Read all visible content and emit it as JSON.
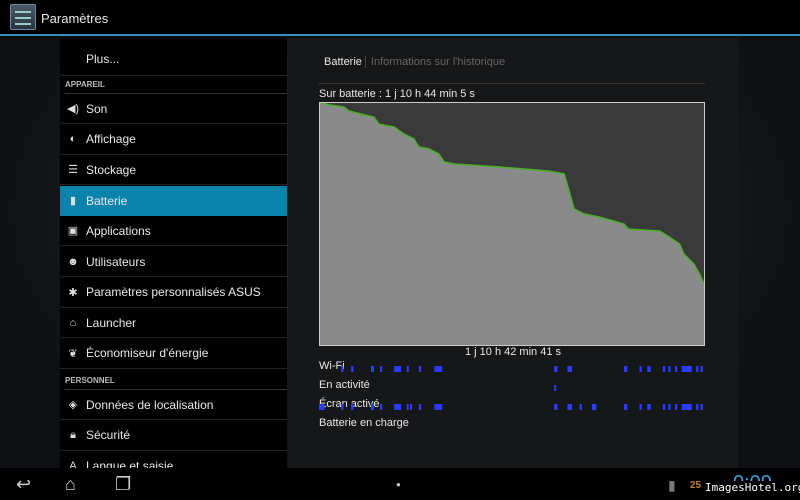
{
  "app": {
    "title": "Paramètres"
  },
  "sidebar": {
    "more": "Plus...",
    "section_device": "APPAREIL",
    "section_personal": "PERSONNEL",
    "items": [
      {
        "label": "Son",
        "icon": "speaker-icon",
        "glyph": "◀)"
      },
      {
        "label": "Affichage",
        "icon": "brightness-icon",
        "glyph": "◐"
      },
      {
        "label": "Stockage",
        "icon": "storage-icon",
        "glyph": "☰"
      },
      {
        "label": "Batterie",
        "icon": "battery-icon",
        "glyph": "▮",
        "selected": true
      },
      {
        "label": "Applications",
        "icon": "apps-icon",
        "glyph": "▣"
      },
      {
        "label": "Utilisateurs",
        "icon": "user-icon",
        "glyph": "☻"
      },
      {
        "label": "Paramètres personnalisés ASUS",
        "icon": "gear-icon",
        "glyph": "✱"
      },
      {
        "label": "Launcher",
        "icon": "home-gear-icon",
        "glyph": "⌂"
      },
      {
        "label": "Économiseur d'énergie",
        "icon": "leaf-icon",
        "glyph": "❦"
      }
    ],
    "personal_items": [
      {
        "label": "Données de localisation",
        "icon": "location-icon",
        "glyph": "◈"
      },
      {
        "label": "Sécurité",
        "icon": "lock-icon",
        "glyph": "🔒︎"
      },
      {
        "label": "Langue et saisie",
        "icon": "language-icon",
        "glyph": "A"
      }
    ]
  },
  "panel": {
    "tabs": [
      "Batterie",
      "Informations sur l'historique"
    ],
    "on_battery": "Sur batterie : 1 j 10 h 44 min 5 s",
    "duration": "1 j 10 h 42 min 41 s",
    "rows": [
      "Wi-Fi",
      "En activité",
      "Écran activé",
      "Batterie en charge"
    ]
  },
  "battery_history": {
    "colors": {
      "fill": "#8a8a8a",
      "line": "#4caf2a",
      "bars": "#2b3cff"
    },
    "total_hours": 34.71,
    "level_points": [
      [
        0,
        100
      ],
      [
        0.9,
        98.8
      ],
      [
        2.25,
        97.9
      ],
      [
        2.7,
        96.3
      ],
      [
        4.96,
        93.8
      ],
      [
        5.4,
        90.9
      ],
      [
        6.76,
        89.7
      ],
      [
        7.66,
        86.8
      ],
      [
        8.56,
        84.8
      ],
      [
        9.0,
        81.5
      ],
      [
        9.9,
        80.7
      ],
      [
        10.8,
        78.6
      ],
      [
        11.3,
        75.3
      ],
      [
        12.2,
        74.5
      ],
      [
        16.2,
        73.3
      ],
      [
        20.7,
        71.6
      ],
      [
        22.1,
        70.4
      ],
      [
        22.5,
        64.2
      ],
      [
        23.0,
        56.0
      ],
      [
        23.9,
        53.9
      ],
      [
        25.2,
        52.7
      ],
      [
        26.6,
        51.0
      ],
      [
        27.5,
        49.8
      ],
      [
        27.9,
        47.7
      ],
      [
        30.7,
        46.9
      ],
      [
        31.6,
        44.4
      ],
      [
        32.5,
        41.6
      ],
      [
        32.9,
        37.4
      ],
      [
        33.8,
        33.3
      ],
      [
        34.3,
        29.2
      ],
      [
        34.71,
        25.1
      ]
    ],
    "wifi": [
      [
        2.0,
        2.2
      ],
      [
        2.9,
        3.1
      ],
      [
        4.69,
        4.96
      ],
      [
        5.5,
        5.7
      ],
      [
        6.77,
        7.4
      ],
      [
        7.9,
        8.1
      ],
      [
        9.0,
        9.2
      ],
      [
        10.4,
        11.1
      ],
      [
        21.2,
        21.5
      ],
      [
        22.4,
        22.8
      ],
      [
        27.5,
        27.8
      ],
      [
        28.9,
        29.1
      ],
      [
        29.6,
        29.9
      ],
      [
        31.0,
        31.2
      ],
      [
        31.5,
        31.7
      ],
      [
        32.1,
        32.3
      ],
      [
        32.7,
        33.6
      ],
      [
        34.0,
        34.2
      ],
      [
        34.4,
        34.6
      ]
    ],
    "awake": [
      [
        21.2,
        21.35
      ]
    ],
    "screen": [
      [
        0,
        0.5
      ],
      [
        2.0,
        2.2
      ],
      [
        2.9,
        3.1
      ],
      [
        4.69,
        4.96
      ],
      [
        5.5,
        5.7
      ],
      [
        6.77,
        7.4
      ],
      [
        7.9,
        8.0
      ],
      [
        8.2,
        8.3
      ],
      [
        9.0,
        9.2
      ],
      [
        10.4,
        11.1
      ],
      [
        21.2,
        21.5
      ],
      [
        22.4,
        22.8
      ],
      [
        23.5,
        23.7
      ],
      [
        24.6,
        25.0
      ],
      [
        27.5,
        27.8
      ],
      [
        28.9,
        29.1
      ],
      [
        29.6,
        29.9
      ],
      [
        31.0,
        31.2
      ],
      [
        31.5,
        31.7
      ],
      [
        32.1,
        32.3
      ],
      [
        32.7,
        33.6
      ],
      [
        34.0,
        34.2
      ],
      [
        34.4,
        34.6
      ]
    ],
    "charging": []
  },
  "status": {
    "clock": "0:09",
    "notification_badge": "25"
  },
  "watermark": "ImagesHotel.org"
}
